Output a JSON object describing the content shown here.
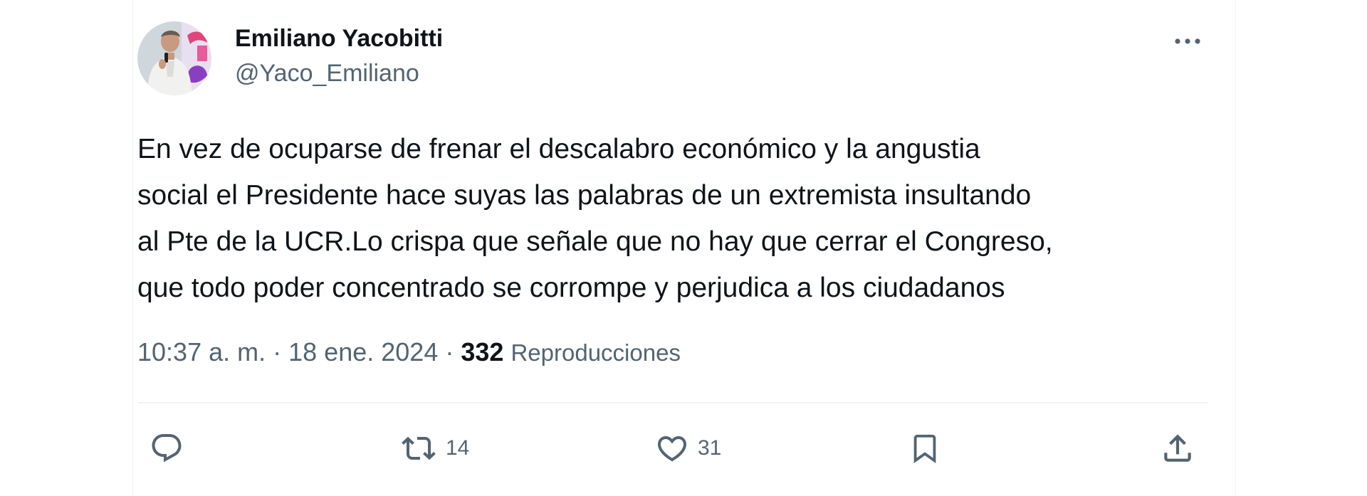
{
  "author": {
    "display_name": "Emiliano Yacobitti",
    "handle": "@Yaco_Emiliano"
  },
  "tweet": {
    "text_lines": [
      "En vez de ocuparse de frenar el descalabro económico y la angustia",
      "social el Presidente hace suyas las palabras de un extremista insultando",
      "al Pte de la UCR.Lo crispa que señale que no hay que cerrar el Congreso,",
      "que todo poder concentrado se corrompe y perjudica a los ciudadanos"
    ],
    "time": "10:37 a. m.",
    "separator": "·",
    "date": "18 ene. 2024",
    "views_count": "332",
    "views_label": "Reproducciones"
  },
  "actions": {
    "reply": {
      "icon": "reply-icon"
    },
    "retweet": {
      "icon": "retweet-icon",
      "count": "14"
    },
    "like": {
      "icon": "heart-icon",
      "count": "31"
    },
    "bookmark": {
      "icon": "bookmark-icon"
    },
    "share": {
      "icon": "share-icon"
    }
  },
  "more": {
    "icon": "more-dots-icon"
  },
  "colors": {
    "text": "#0f1419",
    "secondary": "#536471",
    "divider": "#eff3f4"
  }
}
